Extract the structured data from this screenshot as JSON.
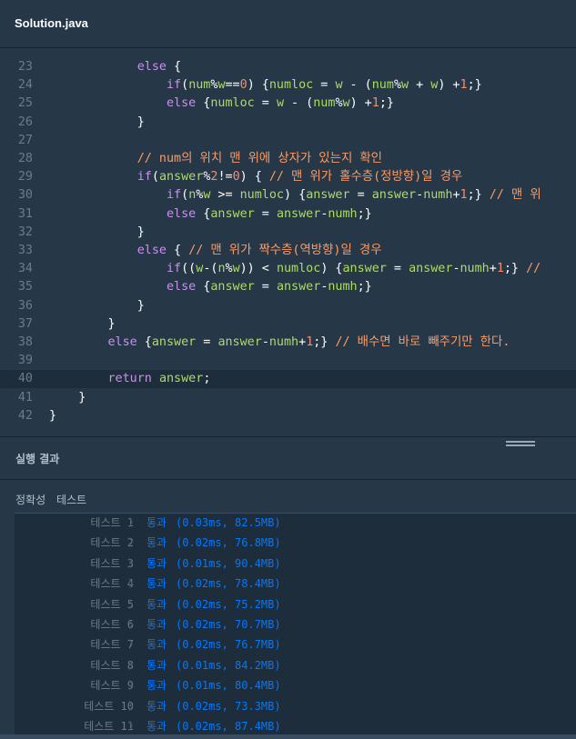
{
  "editor": {
    "file_tab": "Solution.java",
    "lines": [
      {
        "n": "23",
        "tokens": [
          [
            "p",
            "            "
          ],
          [
            "kw",
            "else"
          ],
          [
            "p",
            " {"
          ]
        ]
      },
      {
        "n": "24",
        "tokens": [
          [
            "p",
            "                "
          ],
          [
            "kw",
            "if"
          ],
          [
            "p",
            "("
          ],
          [
            "var",
            "num"
          ],
          [
            "p",
            "%"
          ],
          [
            "var",
            "w"
          ],
          [
            "p",
            "=="
          ],
          [
            "num",
            "0"
          ],
          [
            "p",
            ") {"
          ],
          [
            "var",
            "numloc"
          ],
          [
            "p",
            " = "
          ],
          [
            "var",
            "w"
          ],
          [
            "p",
            " - ("
          ],
          [
            "var",
            "num"
          ],
          [
            "p",
            "%"
          ],
          [
            "var",
            "w"
          ],
          [
            "p",
            " + "
          ],
          [
            "var",
            "w"
          ],
          [
            "p",
            ") +"
          ],
          [
            "num",
            "1"
          ],
          [
            "p",
            ";}"
          ]
        ]
      },
      {
        "n": "25",
        "tokens": [
          [
            "p",
            "                "
          ],
          [
            "kw",
            "else"
          ],
          [
            "p",
            " {"
          ],
          [
            "var",
            "numloc"
          ],
          [
            "p",
            " = "
          ],
          [
            "var",
            "w"
          ],
          [
            "p",
            " - ("
          ],
          [
            "var",
            "num"
          ],
          [
            "p",
            "%"
          ],
          [
            "var",
            "w"
          ],
          [
            "p",
            ") +"
          ],
          [
            "num",
            "1"
          ],
          [
            "p",
            ";}"
          ]
        ]
      },
      {
        "n": "26",
        "tokens": [
          [
            "p",
            "            }"
          ]
        ]
      },
      {
        "n": "27",
        "tokens": []
      },
      {
        "n": "28",
        "tokens": [
          [
            "p",
            "            "
          ],
          [
            "cm",
            "// num의 위치 맨 위에 상자가 있는지 확인"
          ]
        ]
      },
      {
        "n": "29",
        "tokens": [
          [
            "p",
            "            "
          ],
          [
            "kw",
            "if"
          ],
          [
            "p",
            "("
          ],
          [
            "var",
            "answer"
          ],
          [
            "p",
            "%"
          ],
          [
            "num",
            "2"
          ],
          [
            "p",
            "!="
          ],
          [
            "num",
            "0"
          ],
          [
            "p",
            ") { "
          ],
          [
            "cm",
            "// 맨 위가 홀수층(정방향)일 경우"
          ]
        ]
      },
      {
        "n": "30",
        "tokens": [
          [
            "p",
            "                "
          ],
          [
            "kw",
            "if"
          ],
          [
            "p",
            "("
          ],
          [
            "var",
            "n"
          ],
          [
            "p",
            "%"
          ],
          [
            "var",
            "w"
          ],
          [
            "p",
            " >= "
          ],
          [
            "var",
            "numloc"
          ],
          [
            "p",
            ") {"
          ],
          [
            "var",
            "answer"
          ],
          [
            "p",
            " = "
          ],
          [
            "var",
            "answer"
          ],
          [
            "p",
            "-"
          ],
          [
            "var",
            "numh"
          ],
          [
            "p",
            "+"
          ],
          [
            "num",
            "1"
          ],
          [
            "p",
            ";} "
          ],
          [
            "cm",
            "// 맨 위"
          ]
        ]
      },
      {
        "n": "31",
        "tokens": [
          [
            "p",
            "                "
          ],
          [
            "kw",
            "else"
          ],
          [
            "p",
            " {"
          ],
          [
            "var",
            "answer"
          ],
          [
            "p",
            " = "
          ],
          [
            "var",
            "answer"
          ],
          [
            "p",
            "-"
          ],
          [
            "var",
            "numh"
          ],
          [
            "p",
            ";}"
          ]
        ]
      },
      {
        "n": "32",
        "tokens": [
          [
            "p",
            "            }"
          ]
        ]
      },
      {
        "n": "33",
        "tokens": [
          [
            "p",
            "            "
          ],
          [
            "kw",
            "else"
          ],
          [
            "p",
            " { "
          ],
          [
            "cm",
            "// 맨 위가 짝수층(역방향)일 경우"
          ]
        ]
      },
      {
        "n": "34",
        "tokens": [
          [
            "p",
            "                "
          ],
          [
            "kw",
            "if"
          ],
          [
            "p",
            "(("
          ],
          [
            "var",
            "w"
          ],
          [
            "p",
            "-("
          ],
          [
            "var",
            "n"
          ],
          [
            "p",
            "%"
          ],
          [
            "var",
            "w"
          ],
          [
            "p",
            ")) < "
          ],
          [
            "var",
            "numloc"
          ],
          [
            "p",
            ") {"
          ],
          [
            "var",
            "answer"
          ],
          [
            "p",
            " = "
          ],
          [
            "var",
            "answer"
          ],
          [
            "p",
            "-"
          ],
          [
            "var",
            "numh"
          ],
          [
            "p",
            "+"
          ],
          [
            "num",
            "1"
          ],
          [
            "p",
            ";} "
          ],
          [
            "cm",
            "//"
          ]
        ]
      },
      {
        "n": "35",
        "tokens": [
          [
            "p",
            "                "
          ],
          [
            "kw",
            "else"
          ],
          [
            "p",
            " {"
          ],
          [
            "var",
            "answer"
          ],
          [
            "p",
            " = "
          ],
          [
            "var",
            "answer"
          ],
          [
            "p",
            "-"
          ],
          [
            "var",
            "numh"
          ],
          [
            "p",
            ";}"
          ]
        ]
      },
      {
        "n": "36",
        "tokens": [
          [
            "p",
            "            }"
          ]
        ]
      },
      {
        "n": "37",
        "tokens": [
          [
            "p",
            "        }"
          ]
        ]
      },
      {
        "n": "38",
        "tokens": [
          [
            "p",
            "        "
          ],
          [
            "kw",
            "else"
          ],
          [
            "p",
            " {"
          ],
          [
            "var",
            "answer"
          ],
          [
            "p",
            " = "
          ],
          [
            "var",
            "answer"
          ],
          [
            "p",
            "-"
          ],
          [
            "var",
            "numh"
          ],
          [
            "p",
            "+"
          ],
          [
            "num",
            "1"
          ],
          [
            "p",
            ";} "
          ],
          [
            "cm",
            "// 배수면 바로 빼주기만 한다."
          ]
        ]
      },
      {
        "n": "39",
        "tokens": []
      },
      {
        "n": "40",
        "tokens": [
          [
            "p",
            "        "
          ],
          [
            "kw",
            "return"
          ],
          [
            "p",
            " "
          ],
          [
            "var",
            "answer"
          ],
          [
            "p",
            ";"
          ]
        ]
      },
      {
        "n": "41",
        "tokens": [
          [
            "p",
            "    }"
          ]
        ]
      },
      {
        "n": "42",
        "tokens": [
          [
            "p",
            "}"
          ]
        ]
      }
    ],
    "active_line": "40"
  },
  "results": {
    "section_title": "실행 결과",
    "tabs": [
      "정확성",
      "테스트"
    ],
    "rows": [
      {
        "name": "테스트 1",
        "status": "통과",
        "detail": "(0.03ms, 82.5MB)"
      },
      {
        "name": "테스트 2",
        "status": "통과",
        "detail": "(0.02ms, 76.8MB)"
      },
      {
        "name": "테스트 3",
        "status": "통과",
        "detail": "(0.01ms, 90.4MB)"
      },
      {
        "name": "테스트 4",
        "status": "통과",
        "detail": "(0.02ms, 78.4MB)"
      },
      {
        "name": "테스트 5",
        "status": "통과",
        "detail": "(0.02ms, 75.2MB)"
      },
      {
        "name": "테스트 6",
        "status": "통과",
        "detail": "(0.02ms, 70.7MB)"
      },
      {
        "name": "테스트 7",
        "status": "통과",
        "detail": "(0.02ms, 76.7MB)"
      },
      {
        "name": "테스트 8",
        "status": "통과",
        "detail": "(0.01ms, 84.2MB)"
      },
      {
        "name": "테스트 9",
        "status": "통과",
        "detail": "(0.01ms, 80.4MB)"
      },
      {
        "name": "테스트 10",
        "status": "통과",
        "detail": "(0.02ms, 73.3MB)"
      },
      {
        "name": "테스트 11",
        "status": "통과",
        "detail": "(0.02ms, 87.4MB)"
      }
    ],
    "chevron": "〉"
  },
  "colors": {
    "background": "#263747",
    "keyword": "#c792ea",
    "variable": "#addb67",
    "number": "#f78c6c",
    "comment": "#ff9a62",
    "pass": "#0078ff"
  }
}
